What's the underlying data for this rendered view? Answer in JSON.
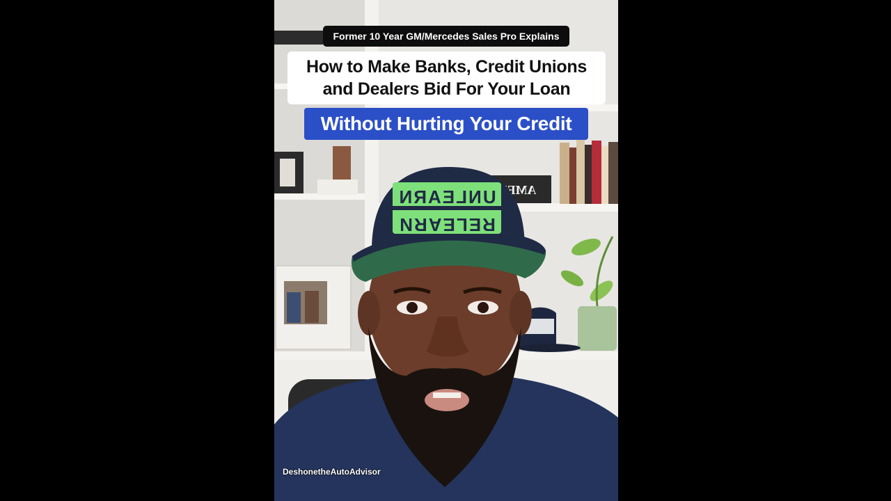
{
  "video": {
    "caption_top": "Former 10 Year GM/Mercedes Sales Pro Explains",
    "headline_line1": "How to Make Banks, Credit Unions",
    "headline_line2": "and Dealers Bid For Your Loan",
    "subheadline": "Without Hurting Your Credit",
    "watermark": "DeshonetheAutoAdvisor",
    "cap_front_text": "UNLEARN",
    "cap_front_text2": "RELEARN",
    "shelf_sign": "AMEN"
  },
  "colors": {
    "letterbox": "#000000",
    "caption_bg": "#0d0d0d",
    "headline_bg": "#ffffff",
    "subheadline_bg": "#2b4fc7",
    "cap_navy": "#1f2a44",
    "cap_green": "#2f6b4a",
    "cap_patch": "#7ee07a"
  }
}
